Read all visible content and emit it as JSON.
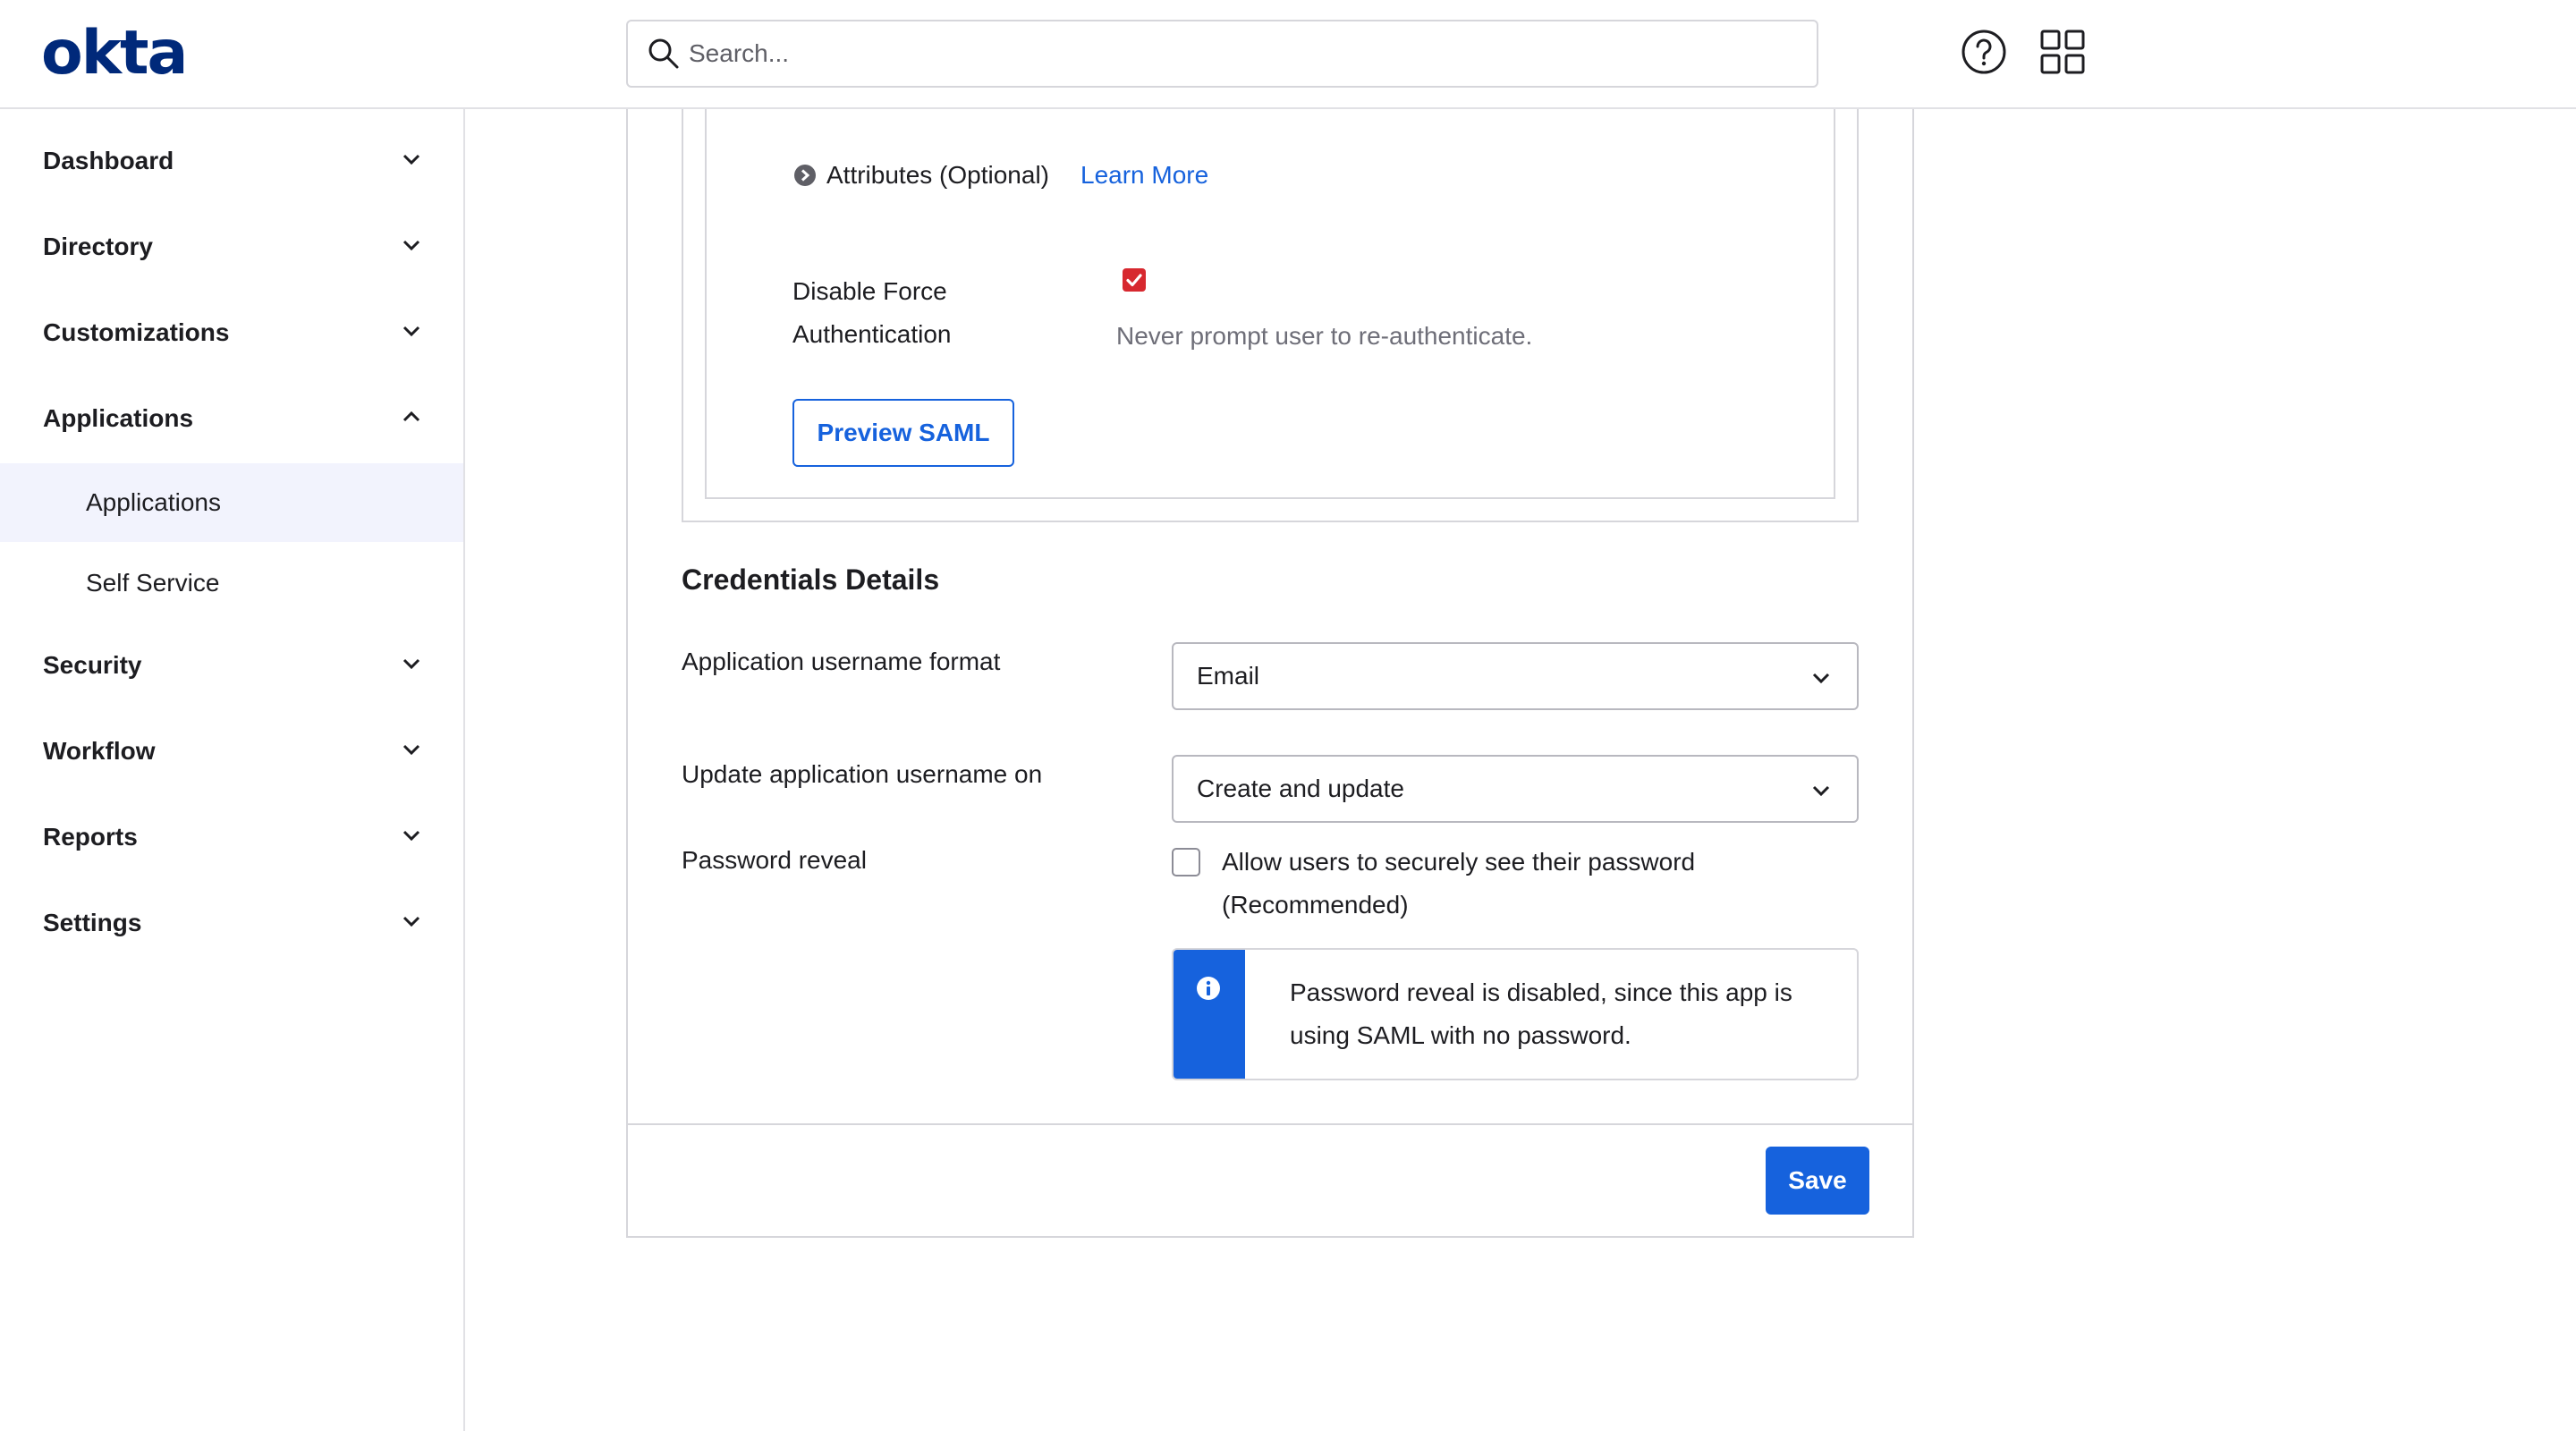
{
  "header": {
    "logo": "okta",
    "search": {
      "placeholder": "Search..."
    },
    "icons": [
      "search-icon",
      "help-icon",
      "apps-grid-icon"
    ]
  },
  "sidebar": {
    "items": [
      {
        "label": "Dashboard",
        "expanded": false
      },
      {
        "label": "Directory",
        "expanded": false
      },
      {
        "label": "Customizations",
        "expanded": false
      },
      {
        "label": "Applications",
        "expanded": true,
        "children": [
          {
            "label": "Applications",
            "active": true
          },
          {
            "label": "Self Service",
            "active": false
          }
        ]
      },
      {
        "label": "Security",
        "expanded": false
      },
      {
        "label": "Workflow",
        "expanded": false
      },
      {
        "label": "Reports",
        "expanded": false
      },
      {
        "label": "Settings",
        "expanded": false
      }
    ]
  },
  "saml": {
    "attributes_label": "Attributes (Optional)",
    "learn_more": "Learn More",
    "disable_force_auth_label": "Disable Force Authentication",
    "disable_force_auth_checked": true,
    "disable_force_auth_desc": "Never prompt user to re-authenticate.",
    "preview_button": "Preview SAML"
  },
  "credentials": {
    "title": "Credentials Details",
    "username_format_label": "Application username format",
    "username_format_value": "Email",
    "update_on_label": "Update application username on",
    "update_on_value": "Create and update",
    "password_reveal_label": "Password reveal",
    "password_reveal_checked": false,
    "password_reveal_text": "Allow users to securely see their password (Recommended)",
    "callout_text": "Password reveal is disabled, since this app is using SAML with no password."
  },
  "footer": {
    "save_label": "Save"
  },
  "colors": {
    "brand": "#00297a",
    "primary": "#1662dd",
    "checkbox_checked": "#d7282f",
    "active_nav_bg": "#f2f3fd"
  }
}
